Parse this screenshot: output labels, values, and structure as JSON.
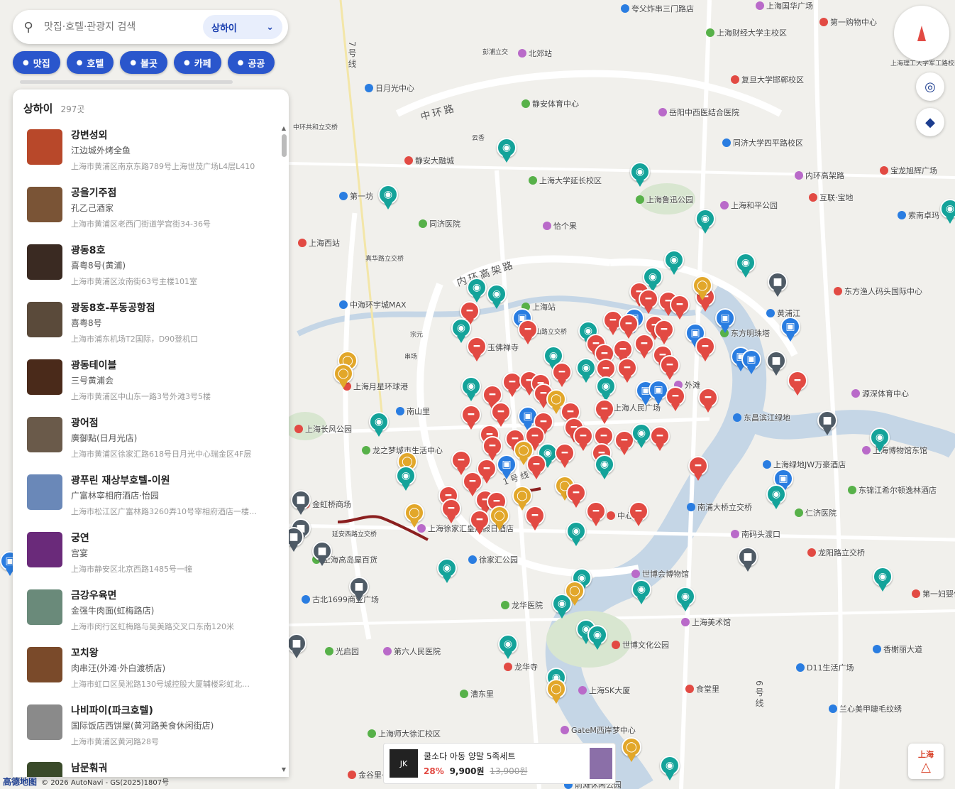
{
  "search": {
    "placeholder": "맛집·호텔·관광지 검색",
    "city": "상하이"
  },
  "categories": [
    {
      "label": "맛집"
    },
    {
      "label": "호텔"
    },
    {
      "label": "볼곳"
    },
    {
      "label": "카페"
    },
    {
      "label": "공공"
    }
  ],
  "panel": {
    "title": "상하이",
    "count": "297곳",
    "items": [
      {
        "name": "강변성외",
        "cn": "江边城外烤全鱼",
        "address": "上海市黄浦区南京东路789号上海世茂广场L4层L410",
        "thumb": "#b8482a"
      },
      {
        "name": "공을기주점",
        "cn": "孔乙己酒家",
        "address": "上海市黄浦区老西门街道学宫街34-36号",
        "thumb": "#7a5436"
      },
      {
        "name": "광동8호",
        "cn": "喜粤8号(黄浦)",
        "address": "上海市黄浦区汝南街63号主楼101室",
        "thumb": "#3a2a22"
      },
      {
        "name": "광동8호-푸동공항점",
        "cn": "喜粤8号",
        "address": "上海市浦东机场T2国际，D90登机口",
        "thumb": "#5a4a3a"
      },
      {
        "name": "광동테이블",
        "cn": "三号黄浦会",
        "address": "上海市黄浦区中山东一路3号外滩3号5楼",
        "thumb": "#4a2a1a"
      },
      {
        "name": "광어점",
        "cn": "廣御點(日月光店)",
        "address": "上海市黄浦区徐家汇路618号日月光中心瑞金区4F层",
        "thumb": "#6a5a4a"
      },
      {
        "name": "광푸린 재상부호텔-이원",
        "cn": "广富林宰相府酒店·怡园",
        "address": "上海市松江区广富林路3260弄10号宰相府酒店一楼…",
        "thumb": "#6a88b8"
      },
      {
        "name": "궁연",
        "cn": "宫宴",
        "address": "上海市静安区北京西路1485号一幢",
        "thumb": "#6a2a7a"
      },
      {
        "name": "금강우육면",
        "cn": "金强牛肉面(虹梅路店)",
        "address": "上海市闵行区虹梅路与吴美路交叉口东南120米",
        "thumb": "#6a8a7a"
      },
      {
        "name": "꼬치왕",
        "cn": "肉串汪(外滩·外白渡桥店)",
        "address": "上海市虹口区吴淞路130号城控股大厦辅楼彩虹北…",
        "thumb": "#7a4a2a"
      },
      {
        "name": "나비파이(파크호텔)",
        "cn": "国际饭店西饼屋(黄河路美食休闲街店)",
        "address": "上海市黄浦区黄河路28号",
        "thumb": "#8a8a8a"
      },
      {
        "name": "남문훠궈",
        "cn": "",
        "address": "",
        "thumb": "#3a4a2a"
      }
    ]
  },
  "map_labels": [
    {
      "text": "上海国华广场"
    },
    {
      "text": "第一购物中心"
    },
    {
      "text": "夸父炸串三门路店"
    },
    {
      "text": "上海财经大学主校区"
    },
    {
      "text": "北郊站"
    },
    {
      "text": "复旦大学邯郸校区"
    },
    {
      "text": "日月光中心"
    },
    {
      "text": "静安体育中心"
    },
    {
      "text": "岳阳中西医结合医院"
    },
    {
      "text": "静安大融城"
    },
    {
      "text": "同济大学四平路校区"
    },
    {
      "text": "上海大学延长校区"
    },
    {
      "text": "内环高架路"
    },
    {
      "text": "宝龙旭辉广场"
    },
    {
      "text": "第一坊"
    },
    {
      "text": "上海鲁迅公园"
    },
    {
      "text": "上海和平公园"
    },
    {
      "text": "互联·宝地"
    },
    {
      "text": "索南卓玛"
    },
    {
      "text": "同济医院"
    },
    {
      "text": "恰个果"
    },
    {
      "text": "上海西站"
    },
    {
      "text": "中海环宇城MAX"
    },
    {
      "text": "上海站"
    },
    {
      "text": "玉佛禅寺"
    },
    {
      "text": "东方渔人码头国际中心"
    },
    {
      "text": "黄浦江"
    },
    {
      "text": "东方明珠塔"
    },
    {
      "text": "外滩"
    },
    {
      "text": "上海月星环球港"
    },
    {
      "text": "南山里"
    },
    {
      "text": "上海人民广场"
    },
    {
      "text": "源深体育中心"
    },
    {
      "text": "上海长风公园"
    },
    {
      "text": "东昌滨江绿地"
    },
    {
      "text": "龙之梦城市生活中心"
    },
    {
      "text": "上海博物馆东馆"
    },
    {
      "text": "金虹桥商场"
    },
    {
      "text": "上海绿地JW万豪酒店"
    },
    {
      "text": "东锦江希尔顿逸林酒店"
    },
    {
      "text": "上海徐家汇皇冠假日酒店"
    },
    {
      "text": "中心"
    },
    {
      "text": "南浦大桥立交桥"
    },
    {
      "text": "仁济医院"
    },
    {
      "text": "南码头渡口"
    },
    {
      "text": "龙阳路立交桥"
    },
    {
      "text": "徐家汇公园"
    },
    {
      "text": "上海高岛屋百货"
    },
    {
      "text": "世博会博物馆"
    },
    {
      "text": "第一妇婴保健院"
    },
    {
      "text": "古北1699商业广场"
    },
    {
      "text": "龙华医院"
    },
    {
      "text": "上海美术馆"
    },
    {
      "text": "世博文化公园"
    },
    {
      "text": "香榭丽大道"
    },
    {
      "text": "光启园"
    },
    {
      "text": "第六人民医院"
    },
    {
      "text": "龙华寺"
    },
    {
      "text": "D11生活广场"
    },
    {
      "text": "漕东里"
    },
    {
      "text": "上海SK大厦"
    },
    {
      "text": "食堂里"
    },
    {
      "text": "兰心美甲睫毛纹绣"
    },
    {
      "text": "上海师大徐汇校区"
    },
    {
      "text": "GateM西岸梦中心"
    },
    {
      "text": "金谷里·MALL"
    },
    {
      "text": "前滩休闲公园"
    },
    {
      "text": "中环路"
    },
    {
      "text": "内环高架路"
    },
    {
      "text": "7号线"
    },
    {
      "text": "1号线"
    },
    {
      "text": "6号线"
    },
    {
      "text": "上海理工大学军工路校区"
    },
    {
      "text": "彭浦立交"
    },
    {
      "text": "中环共和立交桥"
    },
    {
      "text": "真华路立交桥"
    },
    {
      "text": "延安西路立交桥"
    },
    {
      "text": "云香"
    },
    {
      "text": "串场"
    },
    {
      "text": "宗元"
    },
    {
      "text": "中山路立交桥"
    }
  ],
  "controls": {
    "compass": "compass-icon",
    "locate": "locate-icon",
    "layers": "layers-icon"
  },
  "ad": {
    "title": "쿨소다 아동 양말 5족세트",
    "discount": "28%",
    "price": "9,900원",
    "original": "13,900원"
  },
  "city_badge": "上海",
  "footer": {
    "brand": "高德地图",
    "copyright": "© 2026 AutoNavi - GS(2025)1807号"
  },
  "colors": {
    "food": "#e24a43",
    "hotel": "#2a7de1",
    "sight": "#14a39a",
    "cafe": "#e2a72a",
    "public": "#4f5b66",
    "chip": "#2a56cc"
  }
}
